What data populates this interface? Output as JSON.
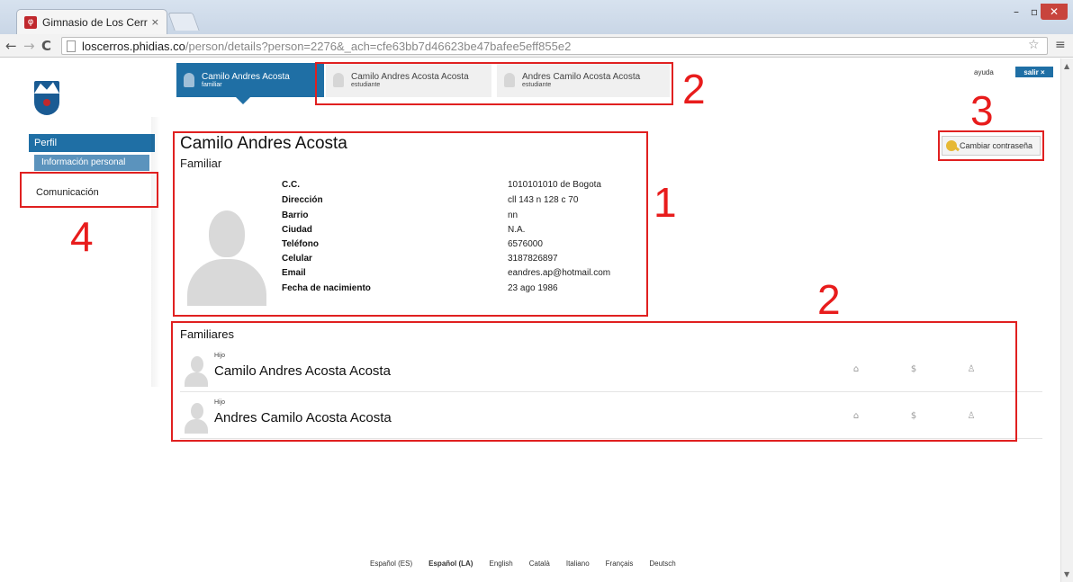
{
  "browser": {
    "tab_title": "Gimnasio de Los Cerros - ",
    "tab_close": "×",
    "url_host": "loscerros.phidias.co",
    "url_path": "/person/details?person=2276&_ach=cfe63bb7d46623be47bafee5eff855e2"
  },
  "header": {
    "help": "ayuda",
    "logout": "salir ×"
  },
  "sidebar": {
    "perfil": "Perfil",
    "info_personal": "Información personal",
    "comunicacion": "Comunicación"
  },
  "person_tabs": [
    {
      "name": "Camilo Andres Acosta",
      "role": "familiar"
    },
    {
      "name": "Camilo Andres Acosta Acosta",
      "role": "estudiante"
    },
    {
      "name": "Andres Camilo Acosta Acosta",
      "role": "estudiante"
    }
  ],
  "profile": {
    "name": "Camilo Andres Acosta",
    "role": "Familiar",
    "fields": [
      {
        "label": "C.C.",
        "value": "1010101010 de Bogota"
      },
      {
        "label": "Dirección",
        "value": "cll 143 n 128 c 70"
      },
      {
        "label": "Barrio",
        "value": "nn"
      },
      {
        "label": "Ciudad",
        "value": "N.A."
      },
      {
        "label": "Teléfono",
        "value": "6576000"
      },
      {
        "label": "Celular",
        "value": "3187826897"
      },
      {
        "label": "Email",
        "value": "eandres.ap@hotmail.com"
      },
      {
        "label": "Fecha de nacimiento",
        "value": "23 ago 1986"
      }
    ]
  },
  "change_password": "Cambiar contraseña",
  "family": {
    "title": "Familiares",
    "members": [
      {
        "relation": "Hijo",
        "name": "Camilo Andres Acosta Acosta"
      },
      {
        "relation": "Hijo",
        "name": "Andres Camilo Acosta Acosta"
      }
    ]
  },
  "annotations": [
    "1",
    "2",
    "3",
    "4",
    "2"
  ],
  "languages": [
    "Español (ES)",
    "Español (LA)",
    "English",
    "Català",
    "Italiano",
    "Français",
    "Deutsch"
  ],
  "colors": {
    "primary": "#1f6fa5",
    "annotation": "#e02020"
  }
}
